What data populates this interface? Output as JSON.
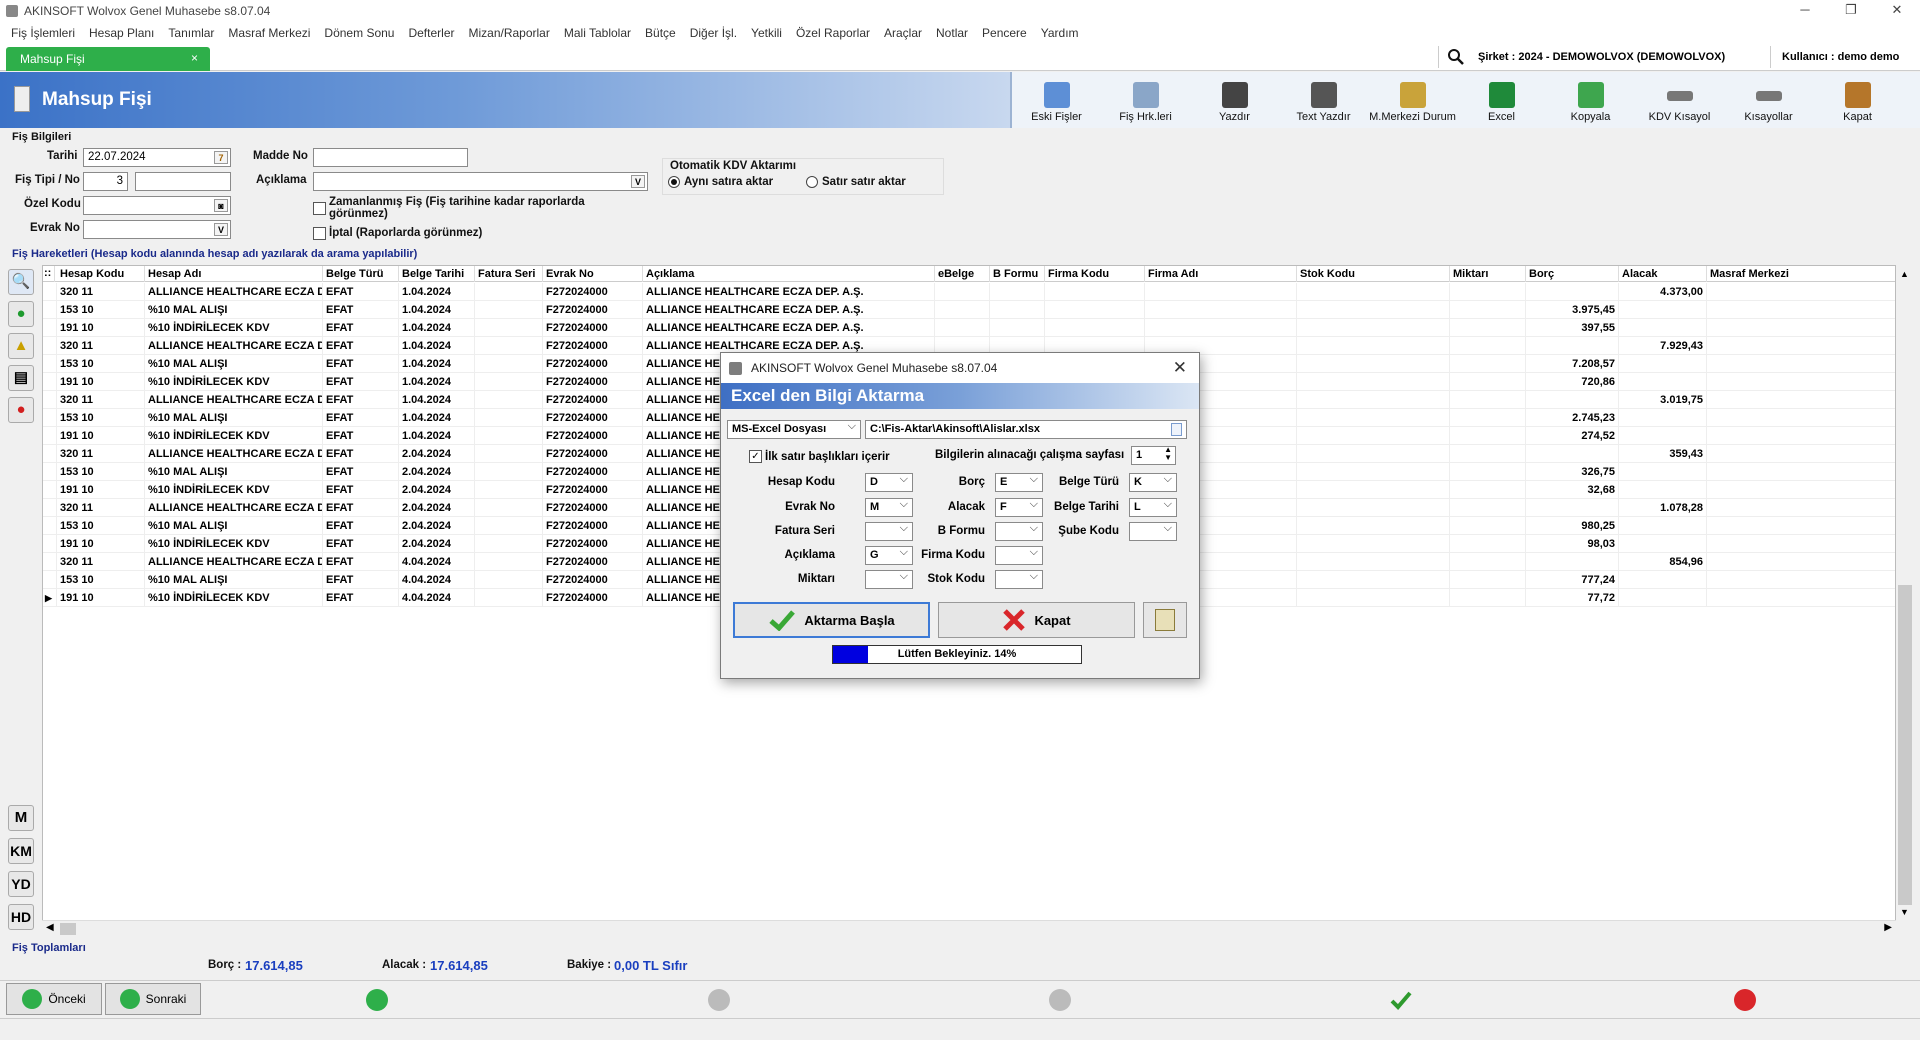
{
  "window": {
    "title": "AKINSOFT Wolvox Genel Muhasebe s8.07.04"
  },
  "menu": [
    "Fiş İşlemleri",
    "Hesap Planı",
    "Tanımlar",
    "Masraf Merkezi",
    "Dönem Sonu",
    "Defterler",
    "Mizan/Raporlar",
    "Mali Tablolar",
    "Bütçe",
    "Diğer İşl.",
    "Yetkili",
    "Özel Raporlar",
    "Araçlar",
    "Notlar",
    "Pencere",
    "Yardım"
  ],
  "tab": {
    "label": "Mahsup Fişi",
    "close": "×"
  },
  "company": "Şirket : 2024 - DEMOWOLVOX (DEMOWOLVOX)",
  "user": "Kullanıcı : demo demo",
  "header": {
    "title": "Mahsup Fişi"
  },
  "toolbar": [
    "Eski Fişler",
    "Fiş Hrk.leri",
    "Yazdır",
    "Text Yazdır",
    "M.Merkezi Durum",
    "Excel",
    "Kopyala",
    "KDV Kısayol",
    "Kısayollar",
    "Kapat"
  ],
  "form": {
    "section": "Fiş Bilgileri",
    "tarih_label": "Tarihi",
    "tarih": "22.07.2024",
    "tarih_btn": "7",
    "fistipi_label": "Fiş Tipi / No",
    "fistipi": "3",
    "fisno": "",
    "ozelkodu_label": "Özel Kodu",
    "ozelkodu": "",
    "evrakno_label": "Evrak No",
    "evrakno": "",
    "dd": "V",
    "maddeno_label": "Madde No",
    "maddeno": "",
    "aciklama_label": "Açıklama",
    "aciklama": "",
    "zamanlanmis": "Zamanlanmış Fiş (Fiş tarihine kadar raporlarda görünmez)",
    "iptal": "İptal (Raporlarda görünmez)",
    "kdv_title": "Otomatik KDV Aktarımı",
    "kdv_opt1": "Aynı satıra aktar",
    "kdv_opt2": "Satır satır aktar"
  },
  "grid": {
    "section": "Fiş Hareketleri (Hesap kodu alanında hesap adı yazılarak da arama yapılabilir)",
    "columns": [
      "Hesap Kodu",
      "Hesap Adı",
      "Belge Türü",
      "Belge Tarihi",
      "Fatura Seri",
      "Evrak No",
      "Açıklama",
      "eBelge",
      "B Formu",
      "Firma Kodu",
      "Firma Adı",
      "Stok Kodu",
      "Miktarı",
      "Borç",
      "Alacak",
      "Masraf Merkezi"
    ],
    "rows": [
      [
        "320 11",
        "ALLIANCE HEALTHCARE ECZA DE",
        "EFAT",
        "1.04.2024",
        "",
        "F272024000",
        "ALLIANCE HEALTHCARE ECZA DEP. A.Ş.",
        "",
        "",
        "",
        "",
        "",
        "",
        "",
        "4.373,00",
        ""
      ],
      [
        "153 10",
        "%10 MAL ALIŞI",
        "EFAT",
        "1.04.2024",
        "",
        "F272024000",
        "ALLIANCE HEALTHCARE ECZA DEP. A.Ş.",
        "",
        "",
        "",
        "",
        "",
        "",
        "3.975,45",
        "",
        ""
      ],
      [
        "191 10",
        "%10 İNDİRİLECEK KDV",
        "EFAT",
        "1.04.2024",
        "",
        "F272024000",
        "ALLIANCE HEALTHCARE ECZA DEP. A.Ş.",
        "",
        "",
        "",
        "",
        "",
        "",
        "397,55",
        "",
        ""
      ],
      [
        "320 11",
        "ALLIANCE HEALTHCARE ECZA DE",
        "EFAT",
        "1.04.2024",
        "",
        "F272024000",
        "ALLIANCE HEALTHCARE ECZA DEP. A.Ş.",
        "",
        "",
        "",
        "",
        "",
        "",
        "",
        "7.929,43",
        ""
      ],
      [
        "153 10",
        "%10 MAL ALIŞI",
        "EFAT",
        "1.04.2024",
        "",
        "F272024000",
        "ALLIANCE HEA",
        "",
        "",
        "",
        "",
        "",
        "",
        "7.208,57",
        "",
        ""
      ],
      [
        "191 10",
        "%10 İNDİRİLECEK KDV",
        "EFAT",
        "1.04.2024",
        "",
        "F272024000",
        "ALLIANCE HEA",
        "",
        "",
        "",
        "",
        "",
        "",
        "720,86",
        "",
        ""
      ],
      [
        "320 11",
        "ALLIANCE HEALTHCARE ECZA DE",
        "EFAT",
        "1.04.2024",
        "",
        "F272024000",
        "ALLIANCE HEA",
        "",
        "",
        "",
        "",
        "",
        "",
        "",
        "3.019,75",
        ""
      ],
      [
        "153 10",
        "%10 MAL ALIŞI",
        "EFAT",
        "1.04.2024",
        "",
        "F272024000",
        "ALLIANCE HEA",
        "",
        "",
        "",
        "",
        "",
        "",
        "2.745,23",
        "",
        ""
      ],
      [
        "191 10",
        "%10 İNDİRİLECEK KDV",
        "EFAT",
        "1.04.2024",
        "",
        "F272024000",
        "ALLIANCE HEA",
        "",
        "",
        "",
        "",
        "",
        "",
        "274,52",
        "",
        ""
      ],
      [
        "320 11",
        "ALLIANCE HEALTHCARE ECZA DE",
        "EFAT",
        "2.04.2024",
        "",
        "F272024000",
        "ALLIANCE HEA",
        "",
        "",
        "",
        "",
        "",
        "",
        "",
        "359,43",
        ""
      ],
      [
        "153 10",
        "%10 MAL ALIŞI",
        "EFAT",
        "2.04.2024",
        "",
        "F272024000",
        "ALLIANCE HEA",
        "",
        "",
        "",
        "",
        "",
        "",
        "326,75",
        "",
        ""
      ],
      [
        "191 10",
        "%10 İNDİRİLECEK KDV",
        "EFAT",
        "2.04.2024",
        "",
        "F272024000",
        "ALLIANCE HEA",
        "",
        "",
        "",
        "",
        "",
        "",
        "32,68",
        "",
        ""
      ],
      [
        "320 11",
        "ALLIANCE HEALTHCARE ECZA DE",
        "EFAT",
        "2.04.2024",
        "",
        "F272024000",
        "ALLIANCE HEA",
        "",
        "",
        "",
        "",
        "",
        "",
        "",
        "1.078,28",
        ""
      ],
      [
        "153 10",
        "%10 MAL ALIŞI",
        "EFAT",
        "2.04.2024",
        "",
        "F272024000",
        "ALLIANCE HEA",
        "",
        "",
        "",
        "",
        "",
        "",
        "980,25",
        "",
        ""
      ],
      [
        "191 10",
        "%10 İNDİRİLECEK KDV",
        "EFAT",
        "2.04.2024",
        "",
        "F272024000",
        "ALLIANCE HEA",
        "",
        "",
        "",
        "",
        "",
        "",
        "98,03",
        "",
        ""
      ],
      [
        "320 11",
        "ALLIANCE HEALTHCARE ECZA DE",
        "EFAT",
        "4.04.2024",
        "",
        "F272024000",
        "ALLIANCE HEA",
        "",
        "",
        "",
        "",
        "",
        "",
        "",
        "854,96",
        ""
      ],
      [
        "153 10",
        "%10 MAL ALIŞI",
        "EFAT",
        "4.04.2024",
        "",
        "F272024000",
        "ALLIANCE HEA",
        "",
        "",
        "",
        "",
        "",
        "",
        "777,24",
        "",
        ""
      ],
      [
        "191 10",
        "%10 İNDİRİLECEK KDV",
        "EFAT",
        "4.04.2024",
        "",
        "F272024000",
        "ALLIANCE HEA",
        "",
        "",
        "",
        "",
        "",
        "",
        "77,72",
        "",
        ""
      ]
    ],
    "row_marker": "▶",
    "corner": "::"
  },
  "leftbar_letters": [
    "M",
    "KM",
    "YD",
    "HD"
  ],
  "totals": {
    "section": "Fiş Toplamları",
    "borc_label": "Borç :",
    "borc": "17.614,85",
    "alacak_label": "Alacak :",
    "alacak": "17.614,85",
    "bakiye_label": "Bakiye :",
    "bakiye": "0,00 TL Sıfır"
  },
  "bottom": {
    "prev": "Önceki",
    "next": "Sonraki"
  },
  "dialog": {
    "title": "AKINSOFT Wolvox Genel Muhasebe s8.07.04",
    "header": "Excel den Bilgi Aktarma",
    "filetype": "MS-Excel Dosyası",
    "filepath": "C:\\Fis-Aktar\\Akinsoft\\Alislar.xlsx",
    "first_row_header": "İlk satır başlıkları içerir",
    "sheet_label": "Bilgilerin alınacağı çalışma sayfası",
    "sheet": "1",
    "fields": {
      "hesap_kodu": {
        "label": "Hesap Kodu",
        "value": "D"
      },
      "evrak_no": {
        "label": "Evrak No",
        "value": "M"
      },
      "fatura_seri": {
        "label": "Fatura Seri",
        "value": ""
      },
      "aciklama": {
        "label": "Açıklama",
        "value": "G"
      },
      "miktari": {
        "label": "Miktarı",
        "value": ""
      },
      "borc": {
        "label": "Borç",
        "value": "E"
      },
      "alacak": {
        "label": "Alacak",
        "value": "F"
      },
      "b_formu": {
        "label": "B Formu",
        "value": ""
      },
      "firma_kodu": {
        "label": "Firma Kodu",
        "value": ""
      },
      "stok_kodu": {
        "label": "Stok Kodu",
        "value": ""
      },
      "belge_turu": {
        "label": "Belge Türü",
        "value": "K"
      },
      "belge_tarihi": {
        "label": "Belge Tarihi",
        "value": "L"
      },
      "sube_kodu": {
        "label": "Şube Kodu",
        "value": ""
      }
    },
    "start_btn": "Aktarma Başla",
    "close_btn": "Kapat",
    "progress_text": "Lütfen Bekleyiniz. 14%",
    "progress": 0.14
  },
  "colors": {
    "accent_green": "#2eaf4a",
    "header_blue": "#3b72c7",
    "progress_blue": "#0000e0",
    "total_blue": "#1a3fbf"
  }
}
